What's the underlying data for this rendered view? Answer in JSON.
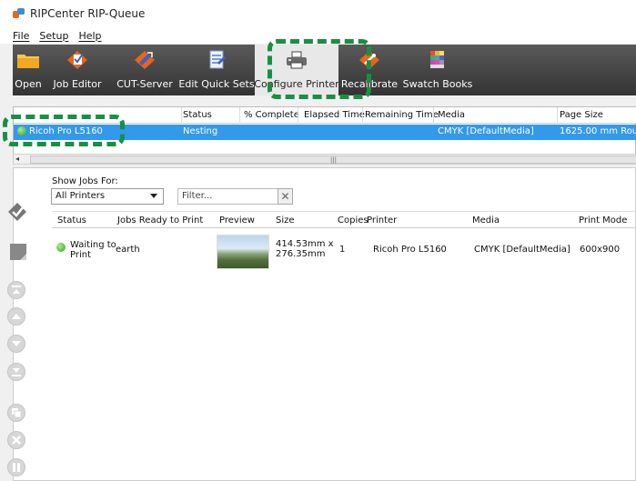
{
  "window": {
    "title": "RIPCenter RIP-Queue"
  },
  "menu": [
    "File",
    "Setup",
    "Help"
  ],
  "toolbar": {
    "items": [
      {
        "label": "Open",
        "icon": "folder-icon"
      },
      {
        "label": "Job Editor",
        "icon": "job-editor-icon"
      },
      {
        "label": "CUT-Server",
        "icon": "cut-server-icon"
      },
      {
        "label": "Edit Quick Sets",
        "icon": "quick-sets-icon"
      },
      {
        "label": "Configure Printer",
        "icon": "printer-icon"
      },
      {
        "label": "Recalibrate",
        "icon": "recalibrate-icon"
      },
      {
        "label": "Swatch Books",
        "icon": "swatch-books-icon"
      }
    ]
  },
  "printer_list": {
    "headers": [
      "Status",
      "% Complete",
      "Elapsed Time",
      "Remaining Time",
      "Media",
      "Page Size"
    ],
    "row": {
      "name": "Ricoh Pro L5160",
      "status": "Nesting",
      "media": "CMYK [DefaultMedia]",
      "page_size": "1625.00 mm Rou..."
    }
  },
  "jobs": {
    "show_jobs_for_label": "Show Jobs For:",
    "show_jobs_for_value": "All Printers",
    "filter_placeholder": "Filter...",
    "headers": [
      "Status",
      "Jobs Ready to Print",
      "Preview",
      "Size",
      "Copies",
      "Printer",
      "Media",
      "Print Mode"
    ],
    "rows": [
      {
        "status_line1": "Waiting to",
        "status_line2": "Print",
        "name": "earth",
        "size_line1": "414.53mm x",
        "size_line2": "276.35mm",
        "copies": "1",
        "printer": "Ricoh Pro L5160",
        "media": "CMYK [DefaultMedia]",
        "print_mode": "600x900"
      }
    ]
  },
  "colors": {
    "accent": "#3399ea",
    "highlight": "#1a8f43",
    "toolbar_bg": "#404040"
  }
}
